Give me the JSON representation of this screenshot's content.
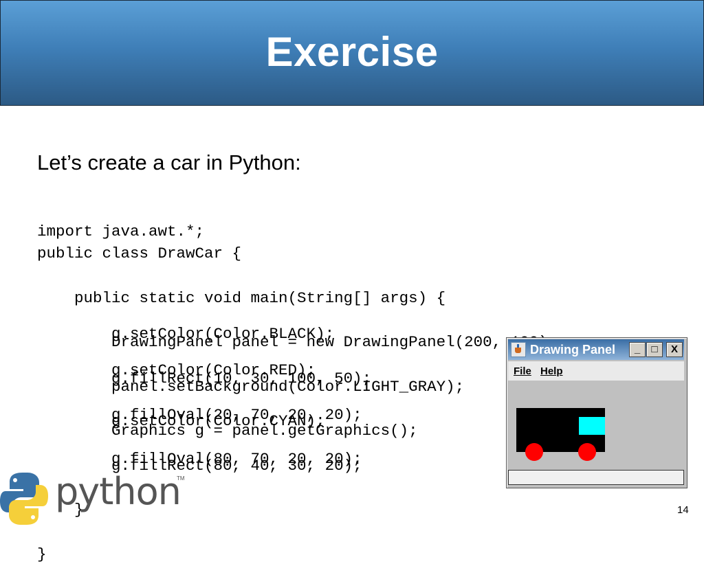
{
  "slide": {
    "title": "Exercise",
    "subtitle": "Let’s create a car in Python:",
    "page_number": "14"
  },
  "code": {
    "import_line": "import java.awt.*;",
    "class_block": [
      "public class DrawCar {",
      "    public static void main(String[] args) {",
      "        DrawingPanel panel = new DrawingPanel(200, 100);",
      "        panel.setBackground(Color.LIGHT_GRAY);",
      "        Graphics g = panel.getGraphics();"
    ],
    "black_block": [
      "        g.setColor(Color.BLACK);",
      "        g.fillRect(10, 30, 100, 50);"
    ],
    "red_block": [
      "        g.setColor(Color.RED);",
      "        g.fillOval(20, 70, 20, 20);",
      "        g.fillOval(80, 70, 20, 20);"
    ],
    "cyan_block": [
      "        g.setColor(Color.CYAN);",
      "        g.fillRect(80, 40, 30, 20);",
      "    }",
      "}"
    ]
  },
  "window": {
    "title": "Drawing Panel",
    "minimize_label": "_",
    "maximize_label": "□",
    "close_label": "X",
    "menu": [
      "File",
      "Help"
    ],
    "icon": "java-cup-icon",
    "colors": {
      "background": "#c0c0c0",
      "body": "#000000",
      "wheels": "#ff0000",
      "window": "#00ffff"
    }
  },
  "logo": {
    "word": "python",
    "trademark": "TM",
    "icon": "python-snakes-icon",
    "colors": {
      "blue": "#3a72a6",
      "yellow": "#f5cf3a"
    }
  },
  "header_colors": {
    "top": "#5b9fd6",
    "bottom": "#2c5a85"
  }
}
